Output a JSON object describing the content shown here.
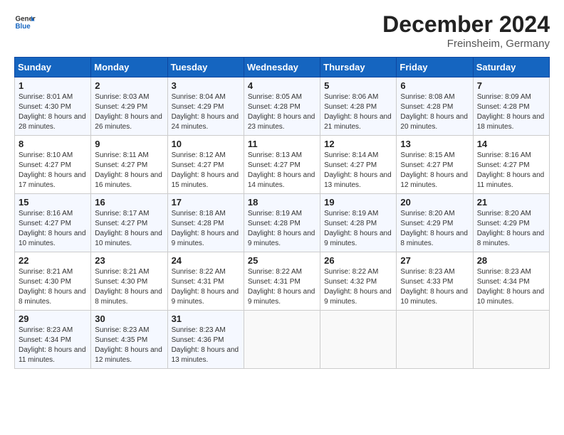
{
  "logo": {
    "text_general": "General",
    "text_blue": "Blue"
  },
  "title": "December 2024",
  "subtitle": "Freinsheim, Germany",
  "days_of_week": [
    "Sunday",
    "Monday",
    "Tuesday",
    "Wednesday",
    "Thursday",
    "Friday",
    "Saturday"
  ],
  "weeks": [
    [
      {
        "day": "1",
        "sunrise": "8:01 AM",
        "sunset": "4:30 PM",
        "daylight": "8 hours and 28 minutes."
      },
      {
        "day": "2",
        "sunrise": "8:03 AM",
        "sunset": "4:29 PM",
        "daylight": "8 hours and 26 minutes."
      },
      {
        "day": "3",
        "sunrise": "8:04 AM",
        "sunset": "4:29 PM",
        "daylight": "8 hours and 24 minutes."
      },
      {
        "day": "4",
        "sunrise": "8:05 AM",
        "sunset": "4:28 PM",
        "daylight": "8 hours and 23 minutes."
      },
      {
        "day": "5",
        "sunrise": "8:06 AM",
        "sunset": "4:28 PM",
        "daylight": "8 hours and 21 minutes."
      },
      {
        "day": "6",
        "sunrise": "8:08 AM",
        "sunset": "4:28 PM",
        "daylight": "8 hours and 20 minutes."
      },
      {
        "day": "7",
        "sunrise": "8:09 AM",
        "sunset": "4:28 PM",
        "daylight": "8 hours and 18 minutes."
      }
    ],
    [
      {
        "day": "8",
        "sunrise": "8:10 AM",
        "sunset": "4:27 PM",
        "daylight": "8 hours and 17 minutes."
      },
      {
        "day": "9",
        "sunrise": "8:11 AM",
        "sunset": "4:27 PM",
        "daylight": "8 hours and 16 minutes."
      },
      {
        "day": "10",
        "sunrise": "8:12 AM",
        "sunset": "4:27 PM",
        "daylight": "8 hours and 15 minutes."
      },
      {
        "day": "11",
        "sunrise": "8:13 AM",
        "sunset": "4:27 PM",
        "daylight": "8 hours and 14 minutes."
      },
      {
        "day": "12",
        "sunrise": "8:14 AM",
        "sunset": "4:27 PM",
        "daylight": "8 hours and 13 minutes."
      },
      {
        "day": "13",
        "sunrise": "8:15 AM",
        "sunset": "4:27 PM",
        "daylight": "8 hours and 12 minutes."
      },
      {
        "day": "14",
        "sunrise": "8:16 AM",
        "sunset": "4:27 PM",
        "daylight": "8 hours and 11 minutes."
      }
    ],
    [
      {
        "day": "15",
        "sunrise": "8:16 AM",
        "sunset": "4:27 PM",
        "daylight": "8 hours and 10 minutes."
      },
      {
        "day": "16",
        "sunrise": "8:17 AM",
        "sunset": "4:27 PM",
        "daylight": "8 hours and 10 minutes."
      },
      {
        "day": "17",
        "sunrise": "8:18 AM",
        "sunset": "4:28 PM",
        "daylight": "8 hours and 9 minutes."
      },
      {
        "day": "18",
        "sunrise": "8:19 AM",
        "sunset": "4:28 PM",
        "daylight": "8 hours and 9 minutes."
      },
      {
        "day": "19",
        "sunrise": "8:19 AM",
        "sunset": "4:28 PM",
        "daylight": "8 hours and 9 minutes."
      },
      {
        "day": "20",
        "sunrise": "8:20 AM",
        "sunset": "4:29 PM",
        "daylight": "8 hours and 8 minutes."
      },
      {
        "day": "21",
        "sunrise": "8:20 AM",
        "sunset": "4:29 PM",
        "daylight": "8 hours and 8 minutes."
      }
    ],
    [
      {
        "day": "22",
        "sunrise": "8:21 AM",
        "sunset": "4:30 PM",
        "daylight": "8 hours and 8 minutes."
      },
      {
        "day": "23",
        "sunrise": "8:21 AM",
        "sunset": "4:30 PM",
        "daylight": "8 hours and 8 minutes."
      },
      {
        "day": "24",
        "sunrise": "8:22 AM",
        "sunset": "4:31 PM",
        "daylight": "8 hours and 9 minutes."
      },
      {
        "day": "25",
        "sunrise": "8:22 AM",
        "sunset": "4:31 PM",
        "daylight": "8 hours and 9 minutes."
      },
      {
        "day": "26",
        "sunrise": "8:22 AM",
        "sunset": "4:32 PM",
        "daylight": "8 hours and 9 minutes."
      },
      {
        "day": "27",
        "sunrise": "8:23 AM",
        "sunset": "4:33 PM",
        "daylight": "8 hours and 10 minutes."
      },
      {
        "day": "28",
        "sunrise": "8:23 AM",
        "sunset": "4:34 PM",
        "daylight": "8 hours and 10 minutes."
      }
    ],
    [
      {
        "day": "29",
        "sunrise": "8:23 AM",
        "sunset": "4:34 PM",
        "daylight": "8 hours and 11 minutes."
      },
      {
        "day": "30",
        "sunrise": "8:23 AM",
        "sunset": "4:35 PM",
        "daylight": "8 hours and 12 minutes."
      },
      {
        "day": "31",
        "sunrise": "8:23 AM",
        "sunset": "4:36 PM",
        "daylight": "8 hours and 13 minutes."
      },
      null,
      null,
      null,
      null
    ]
  ],
  "labels": {
    "sunrise": "Sunrise:",
    "sunset": "Sunset:",
    "daylight": "Daylight:"
  }
}
